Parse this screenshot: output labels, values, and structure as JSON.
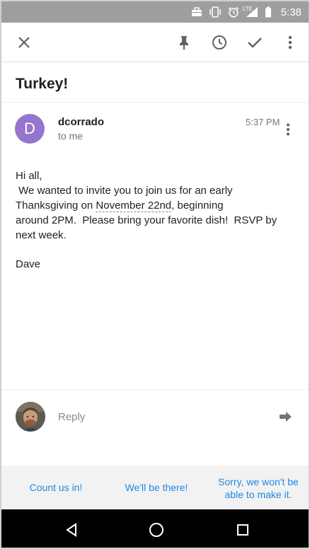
{
  "status_bar": {
    "time": "5:38",
    "network": "LTE",
    "icons": [
      "briefcase-icon",
      "vibrate-icon",
      "alarm-icon",
      "signal-icon",
      "battery-icon"
    ]
  },
  "toolbar": {
    "icons": [
      "close-icon",
      "pin-icon",
      "snooze-icon",
      "done-icon",
      "more-vert-icon"
    ]
  },
  "email": {
    "subject": "Turkey!",
    "sender": {
      "initial": "D",
      "name": "dcorrado",
      "to": "to me",
      "avatar_color": "#9575cd"
    },
    "time": "5:37 PM",
    "body": {
      "greeting": "Hi all,",
      "line1": " We wanted to invite you to join us for an early",
      "line2_pre": "Thanksgiving on ",
      "line2_date": "November 22nd",
      "line2_post": ", beginning",
      "line3": "around 2PM.  Please bring your favorite dish!  RSVP by",
      "line4": "next week.",
      "signature": "Dave"
    }
  },
  "reply": {
    "placeholder": "Reply"
  },
  "smart_replies": {
    "items": [
      {
        "label": "Count us in!"
      },
      {
        "label": "We'll be there!"
      },
      {
        "line1": "Sorry, we won't be",
        "line2": "able to make it."
      }
    ],
    "color": "#1e88e5"
  },
  "nav_bar": {
    "icons": [
      "back-icon",
      "home-icon",
      "recents-icon"
    ]
  }
}
